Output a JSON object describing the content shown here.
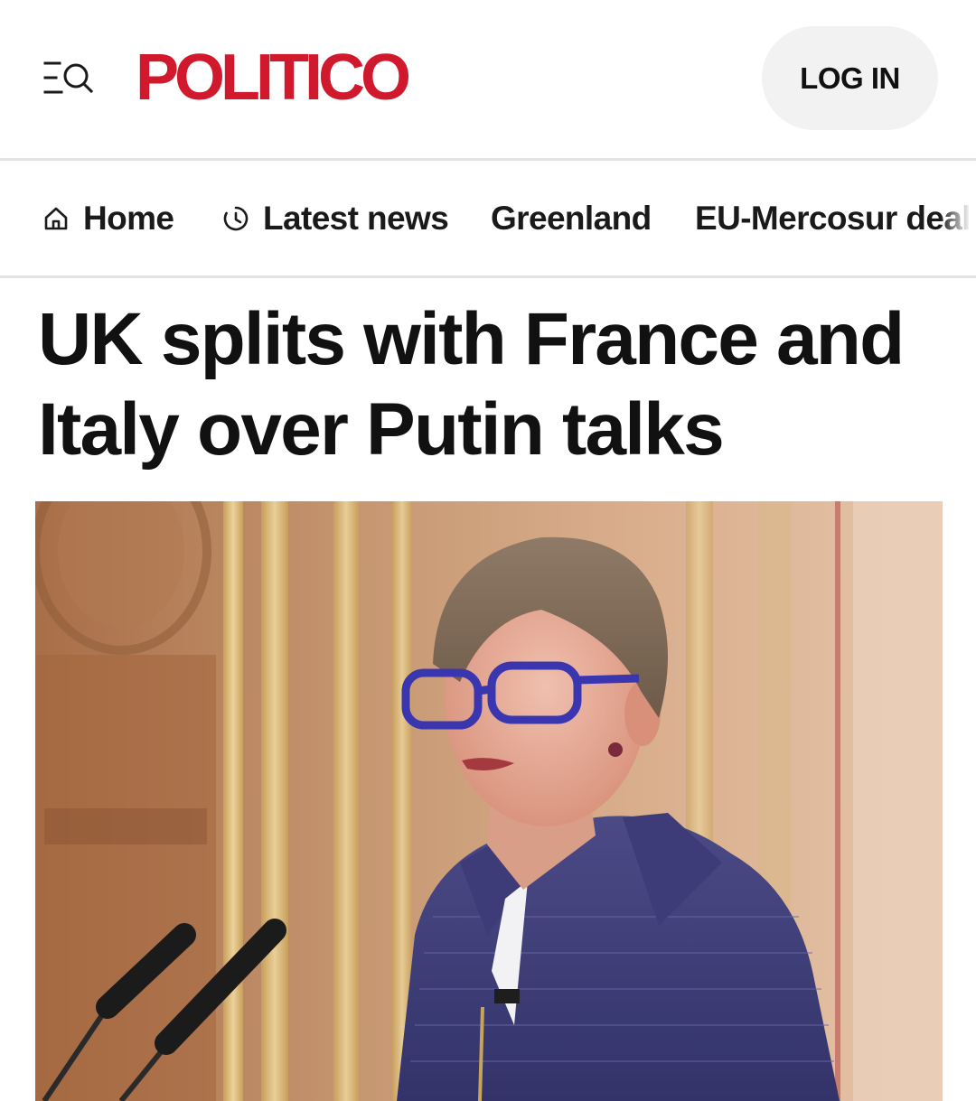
{
  "header": {
    "menu_search_icon": "menu-search-icon",
    "logo_text": "POLITICO",
    "login_label": "LOG IN",
    "brand_color": "#d1192d"
  },
  "nav": {
    "items": [
      {
        "label": "Home",
        "icon": "home-icon"
      },
      {
        "label": "Latest news",
        "icon": "clock-icon"
      },
      {
        "label": "Greenland"
      },
      {
        "label": "EU-Mercosur deal"
      }
    ]
  },
  "article": {
    "headline": "UK splits with France and Italy over Putin talks",
    "hero_image": "photo of a woman with short hair and blue glasses speaking at a podium with two microphones, ornate gilded wall behind"
  }
}
